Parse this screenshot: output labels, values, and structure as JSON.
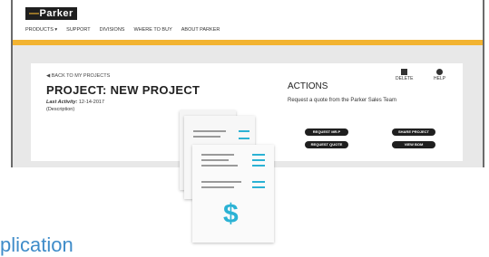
{
  "header": {
    "logo_text": "Parker",
    "nav": [
      "PRODUCTS ▾",
      "SUPPORT",
      "DIVISIONS",
      "WHERE TO BUY",
      "ABOUT PARKER"
    ]
  },
  "project": {
    "back_link": "BACK TO MY PROJECTS",
    "title": "PROJECT: NEW PROJECT",
    "last_activity_label": "Last Activity:",
    "last_activity_date": "12-14-2017",
    "description": "(Description)"
  },
  "actions": {
    "heading": "ACTIONS",
    "subtitle": "Request a quote from the Parker Sales Team",
    "delete_label": "DELETE",
    "help_label": "HELP",
    "buttons": {
      "request_mro": "REQUEST MR.P",
      "request_quote": "REQUEST QUOTE",
      "share_project": "SHARE PROJECT",
      "view_bom": "VIEW BOM"
    }
  },
  "overlay": {
    "dollar": "$"
  },
  "bottom_text": "plication",
  "colors": {
    "accent_yellow": "#f2b331",
    "dark": "#1f1f1f",
    "teal": "#2bb2d4",
    "blue_text": "#3f8cc9"
  }
}
